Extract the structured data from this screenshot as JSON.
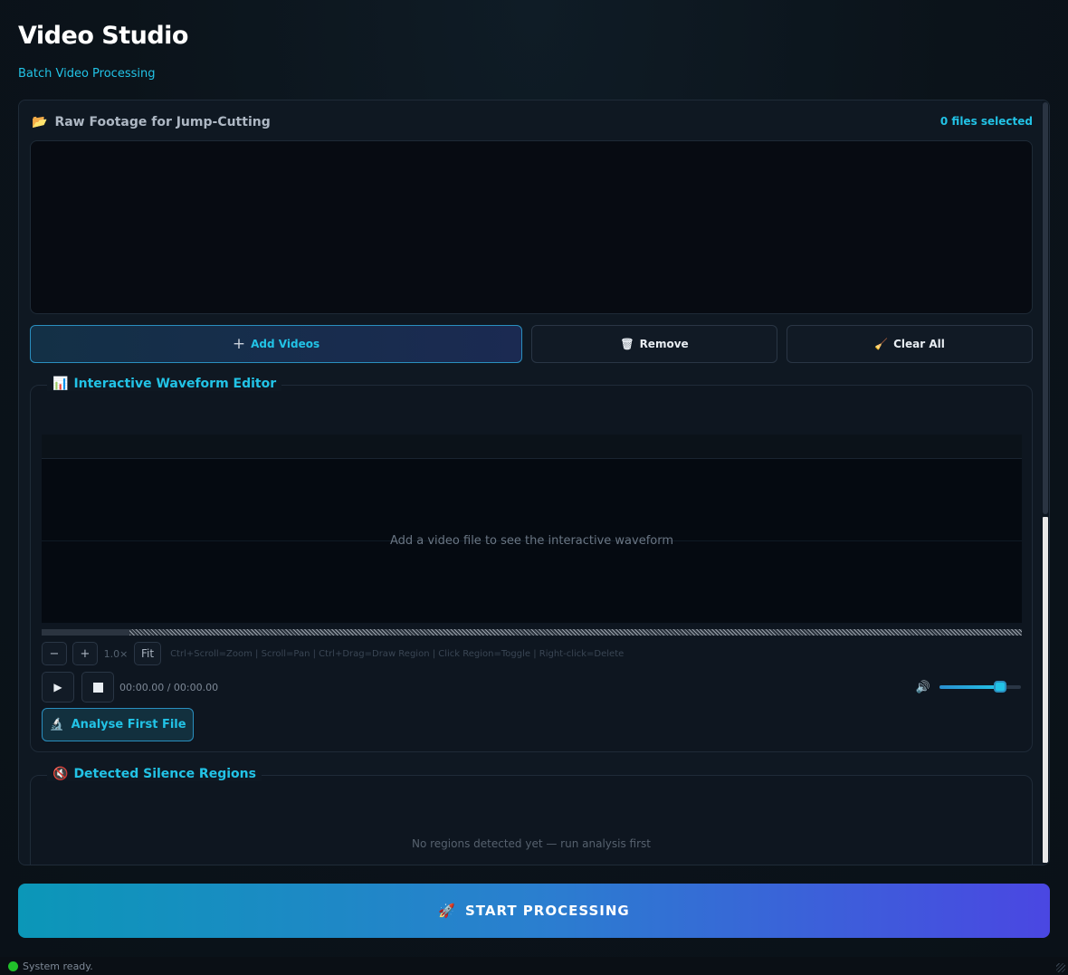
{
  "app": {
    "title": "Video Studio",
    "subtitle": "Batch Video Processing"
  },
  "footage": {
    "icon": "folder-icon",
    "icon_glyph": "📂",
    "title": "Raw Footage for Jump-Cutting",
    "files_count": "0 files selected"
  },
  "buttons": {
    "add_icon": "+",
    "add_label": "Add Videos",
    "remove_icon": "🗑",
    "remove_label": "Remove",
    "clear_icon": "🧹",
    "clear_label": "Clear All"
  },
  "waveform": {
    "icon_glyph": "📊",
    "title": "Interactive Waveform Editor",
    "placeholder": "Add a video file to see the interactive waveform",
    "zoom_out_label": "−",
    "zoom_in_label": "+",
    "zoom_level": "1.0×",
    "fit_label": "Fit",
    "hint": "Ctrl+Scroll=Zoom  |  Scroll=Pan  |  Ctrl+Drag=Draw Region  |  Click Region=Toggle  |  Right-click=Delete",
    "play_glyph": "▶",
    "timecode": "00:00.00 / 00:00.00",
    "volume_glyph": "🔊",
    "volume_level": 0.74,
    "analyse_icon": "🔬",
    "analyse_label": "Analyse First File"
  },
  "silence": {
    "icon_glyph": "🔇",
    "title": "Detected Silence Regions",
    "placeholder": "No regions detected yet — run analysis first"
  },
  "start": {
    "icon_glyph": "🚀",
    "label": "START PROCESSING"
  },
  "status": {
    "text": "System ready.",
    "color": "#21c02a"
  }
}
